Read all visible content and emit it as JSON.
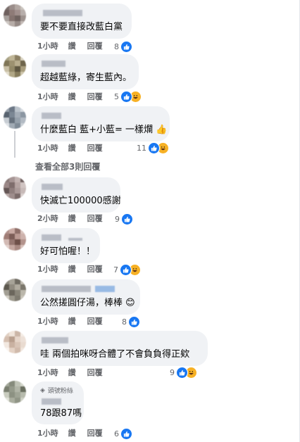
{
  "comments": [
    {
      "text": "要不要直接改藍白黨",
      "time": "1小時",
      "like": "讚",
      "reply": "回覆",
      "count": "8",
      "haha": false
    },
    {
      "text": "超越藍綠，寄生藍內。",
      "time": "1小時",
      "like": "讚",
      "reply": "回覆",
      "count": "5",
      "haha": true
    },
    {
      "text": "什麼藍白 藍+小藍= 一樣爛",
      "thumb": "👍",
      "time": "1小時",
      "like": "讚",
      "reply": "回覆",
      "count": "11",
      "haha": true
    },
    {
      "text": "快滅亡100000感謝",
      "time": "2小時",
      "like": "讚",
      "reply": "回覆",
      "count": "9",
      "haha": false
    },
    {
      "text": "好可怕喔！！",
      "time": "1小時",
      "like": "讚",
      "reply": "回覆",
      "count": "7",
      "haha": true
    },
    {
      "text": "公然搓圓仔湯，棒棒",
      "thumb": "😊",
      "time": "1小時",
      "like": "讚",
      "reply": "回覆",
      "count": "8",
      "haha": false
    },
    {
      "text": "哇 兩個拍咪呀合體了不會負負得正欸",
      "time": "1小時",
      "like": "讚",
      "reply": "回覆",
      "count": "9",
      "haha": true
    },
    {
      "text": "78跟87嗎",
      "badge": "頭號粉絲",
      "time": "1小時",
      "like": "讚",
      "reply": "回覆",
      "count": "6",
      "haha": false
    }
  ],
  "view_more": "查看全部3則回覆",
  "colors": {
    "like_blue": "#1877f2",
    "haha_yellow": "#f7b125",
    "bubble": "#f0f2f5",
    "meta_gray": "#65676b"
  }
}
